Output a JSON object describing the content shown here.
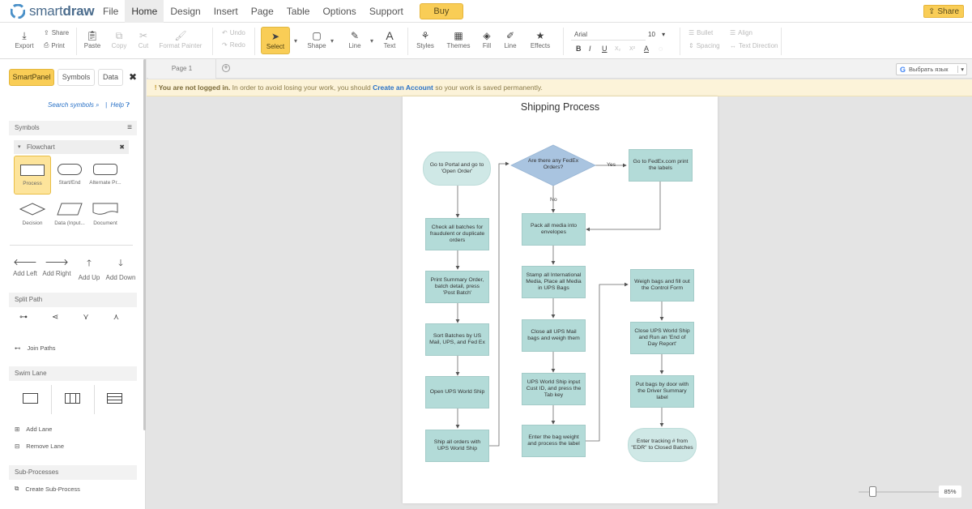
{
  "app": {
    "logo_prefix": "smart",
    "logo_suffix": "draw"
  },
  "menu": {
    "items": [
      "File",
      "Home",
      "Design",
      "Insert",
      "Page",
      "Table",
      "Options",
      "Support"
    ],
    "buy": "Buy",
    "share": "Share"
  },
  "ribbon": {
    "export": "Export",
    "share": "Share",
    "print": "Print",
    "paste": "Paste",
    "copy": "Copy",
    "cut": "Cut",
    "format_painter": "Format Painter",
    "undo": "Undo",
    "redo": "Redo",
    "select": "Select",
    "shape": "Shape",
    "line": "Line",
    "text": "Text",
    "styles": "Styles",
    "themes": "Themes",
    "fill": "Fill",
    "line2": "Line",
    "effects": "Effects",
    "font": "Arial",
    "font_size": "10",
    "bullet": "Bullet",
    "align": "Align",
    "spacing": "Spacing",
    "text_direction": "Text Direction",
    "fmt_bold": "B",
    "fmt_italic": "I",
    "fmt_underline": "U",
    "fmt_sub": "X₂",
    "fmt_sup": "X²",
    "fmt_color": "A"
  },
  "left_panel": {
    "tabs": [
      "SmartPanel",
      "Symbols",
      "Data"
    ],
    "search_symbols": "Search symbols",
    "help": "Help",
    "symbols_header": "Symbols",
    "library": "Flowchart",
    "symbols": [
      "Process",
      "Start/End",
      "Alternate Pr...",
      "Decision",
      "Data (Input...",
      "Document"
    ],
    "add_buttons": [
      "Add Left",
      "Add Right",
      "Add Up",
      "Add Down"
    ],
    "split_path": "Split Path",
    "join_paths": "Join Paths",
    "swim_lane": "Swim Lane",
    "add_lane": "Add Lane",
    "remove_lane": "Remove Lane",
    "sub_processes": "Sub-Processes",
    "create_sub_process": "Create Sub-Process"
  },
  "canvas": {
    "page_tab": "Page 1",
    "language_button": "Выбрать язык",
    "notice_bold": "You are not logged in.",
    "notice_text": " In order to avoid losing your work, you should ",
    "notice_link": "Create an Account",
    "notice_tail": " so your work is saved permanently.",
    "zoom": "85%"
  },
  "diagram": {
    "title": "Shipping Process",
    "nodes": {
      "go_portal": "Go to Portal and go to 'Open Order'",
      "check_batches": "Check all batches for fraudulent or duplicate orders",
      "print_summary": "Print Summary Order, batch detail, press 'Post Batch'",
      "sort_batches": "Sort Batches by US Mail, UPS, and Fed Ex",
      "open_ups": "Open UPS World Ship",
      "ship_orders": "Ship all orders with UPS  World Ship",
      "fedex_decision": "Are there any FedEx Orders?",
      "pack_media": "Pack all media into envelopes",
      "stamp_media": "Stamp all International Media, Place all Media in UPS Bags",
      "close_mail": "Close all UPS Mail bags and weigh them",
      "input_cust": "UPS World Ship input Cust ID, and press the Tab key",
      "enter_weight": "Enter the bag weight and process the label",
      "fedex_print": "Go to FedEx.com print the labels",
      "weigh_bags": "Weigh bags and fill out the Control Form",
      "close_ship": "Close UPS World Ship and Run an 'End of Day Report'",
      "put_bags": "Put bags by door with the Driver Summary label",
      "enter_tracking": "Enter tracking # from \"EDR\" to Closed Batches"
    },
    "labels": {
      "yes": "Yes",
      "no": "No"
    }
  }
}
